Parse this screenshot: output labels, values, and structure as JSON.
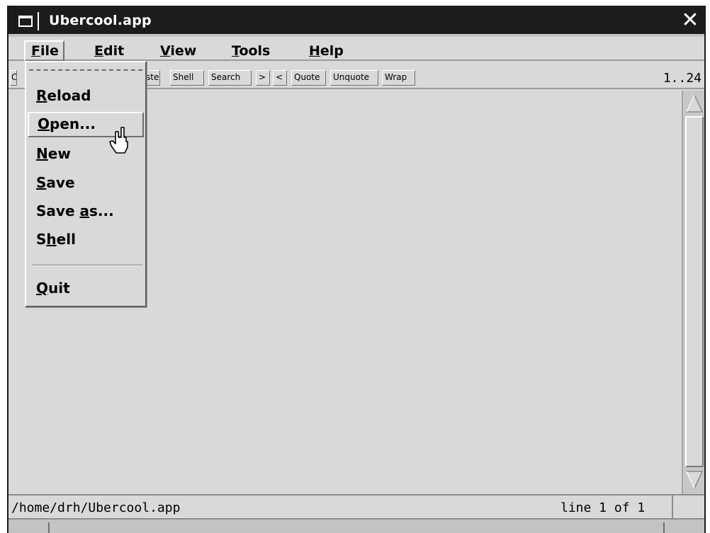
{
  "window": {
    "title": "Ubercool.app",
    "close_glyph": "✕"
  },
  "menubar": {
    "items": [
      {
        "pre": "",
        "u": "F",
        "post": "ile"
      },
      {
        "pre": "",
        "u": "E",
        "post": "dit"
      },
      {
        "pre": "",
        "u": "V",
        "post": "iew"
      },
      {
        "pre": "",
        "u": "T",
        "post": "ools"
      },
      {
        "pre": "",
        "u": "H",
        "post": "elp"
      }
    ]
  },
  "toolbar": {
    "buttons": [
      "C",
      "Paste",
      "Shell",
      "Search",
      ">",
      "<",
      "Quote",
      "Unquote",
      "Wrap"
    ],
    "range": "1..24"
  },
  "file_menu": {
    "items": [
      {
        "pre": "",
        "u": "R",
        "post": "eload"
      },
      {
        "pre": "",
        "u": "O",
        "post": "pen..."
      },
      {
        "pre": "",
        "u": "N",
        "post": "ew"
      },
      {
        "pre": "",
        "u": "S",
        "post": "ave"
      },
      {
        "pre": "Save ",
        "u": "a",
        "post": "s..."
      },
      {
        "pre": "S",
        "u": "h",
        "post": "ell"
      },
      {
        "pre": "",
        "u": "Q",
        "post": "uit"
      }
    ],
    "highlighted": "Open..."
  },
  "statusbar": {
    "path": "/home/drh/Ubercool.app",
    "line": "line 1 of 1"
  },
  "colors": {
    "titlebar": "#1c1c1c",
    "face": "#d9d9d9",
    "text": "#000000"
  }
}
